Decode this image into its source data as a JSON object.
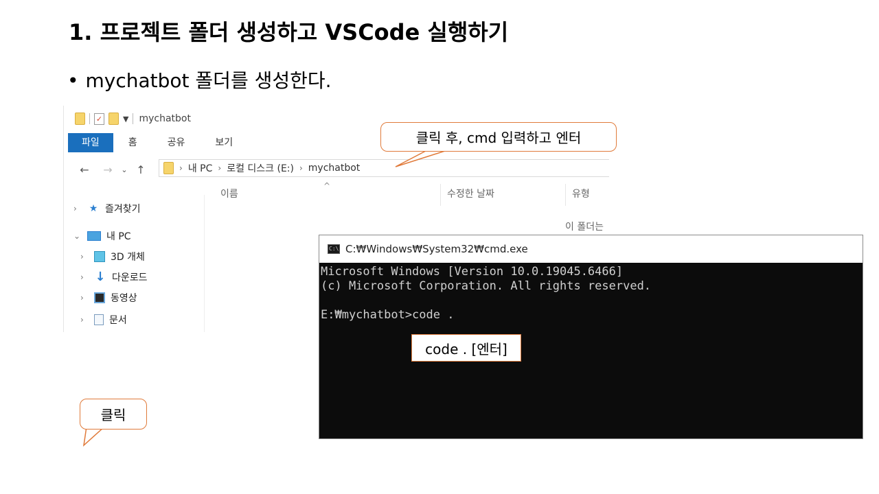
{
  "slide": {
    "title": "1. 프로젝트 폴더 생성하고 VSCode 실행하기",
    "bullet": "mychatbot 폴더를 생성한다."
  },
  "explorer": {
    "window_title": "mychatbot",
    "ribbon_tabs": [
      "파일",
      "홈",
      "공유",
      "보기"
    ],
    "path": [
      "내 PC",
      "로컬 디스크 (E:)",
      "mychatbot"
    ],
    "columns": [
      "이름",
      "수정한 날짜",
      "유형"
    ],
    "empty_message": "이 폴더는",
    "nav_items": [
      {
        "label": "즐겨찾기",
        "icon": "star-icon"
      },
      {
        "label": "내 PC",
        "icon": "pc-icon"
      },
      {
        "label": "3D 개체",
        "icon": "cube-icon"
      },
      {
        "label": "다운로드",
        "icon": "download-icon"
      },
      {
        "label": "동영상",
        "icon": "video-icon"
      },
      {
        "label": "문서",
        "icon": "document-icon"
      }
    ]
  },
  "cmd": {
    "title": "C:₩Windows₩System32₩cmd.exe",
    "lines": [
      "Microsoft Windows [Version 10.0.19045.6466]",
      "(c) Microsoft Corporation. All rights reserved.",
      "",
      "E:₩mychatbot>code ."
    ]
  },
  "callouts": {
    "address_tip": "클릭 후, cmd 입력하고 엔터",
    "code_tip": "code . [엔터]",
    "click_tip": "클릭"
  },
  "colors": {
    "accent": "#e07a3a",
    "ribbon_file": "#1a6fbd",
    "console_bg": "#0c0c0c"
  }
}
